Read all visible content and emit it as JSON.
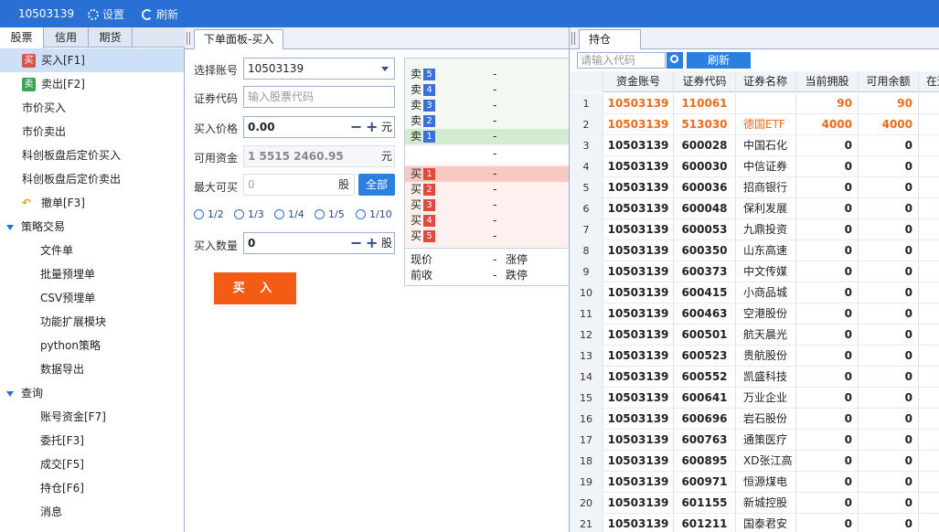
{
  "titlebar": {
    "account": "10503139",
    "settings": "设置",
    "refresh": "刷新"
  },
  "left": {
    "tabs": [
      "股票",
      "信用",
      "期货"
    ],
    "items": [
      {
        "label": "买入[F1]",
        "badge": "买",
        "badge_color": "#d9534f",
        "selected": true
      },
      {
        "label": "卖出[F2]",
        "badge": "卖",
        "badge_color": "#3aa552"
      },
      {
        "label": "市价买入"
      },
      {
        "label": "市价卖出"
      },
      {
        "label": "科创板盘后定价买入"
      },
      {
        "label": "科创板盘后定价卖出"
      },
      {
        "label": "撤单[F3]"
      }
    ],
    "strategy": {
      "header": "策略交易",
      "items": [
        "文件单",
        "批量预埋单",
        "CSV预埋单",
        "功能扩展模块",
        "python策略",
        "数据导出"
      ]
    },
    "query": {
      "header": "查询",
      "items": [
        "账号资金[F7]",
        "委托[F3]",
        "成交[F5]",
        "持仓[F6]",
        "消息"
      ]
    }
  },
  "order_panel": {
    "tab": "下单面板-买入",
    "account_label": "选择账号",
    "account_value": "10503139",
    "code_label": "证券代码",
    "code_placeholder": "输入股票代码",
    "price_label": "买入价格",
    "price_value": "0.00",
    "price_unit": "元",
    "funds_label": "可用资金",
    "funds_value": "1 5515 2460.95",
    "funds_unit": "元",
    "max_label": "最大可买",
    "max_value": "0",
    "max_unit": "股",
    "all_button": "全部",
    "fractions": [
      "1/2",
      "1/3",
      "1/4",
      "1/5",
      "1/10"
    ],
    "qty_label": "买入数量",
    "qty_value": "0",
    "qty_unit": "股",
    "buy_button": "买 入"
  },
  "order_book": {
    "sell": [
      {
        "label": "卖",
        "level": "5",
        "value": "-"
      },
      {
        "label": "卖",
        "level": "4",
        "value": "-"
      },
      {
        "label": "卖",
        "level": "3",
        "value": "-"
      },
      {
        "label": "卖",
        "level": "2",
        "value": "-"
      },
      {
        "label": "卖",
        "level": "1",
        "value": "-"
      }
    ],
    "mid": "-",
    "buy": [
      {
        "label": "买",
        "level": "1",
        "value": "-"
      },
      {
        "label": "买",
        "level": "2",
        "value": "-"
      },
      {
        "label": "买",
        "level": "3",
        "value": "-"
      },
      {
        "label": "买",
        "level": "4",
        "value": "-"
      },
      {
        "label": "买",
        "level": "5",
        "value": "-"
      }
    ],
    "current_label": "现价",
    "current_value": "-",
    "limit_up_label": "涨停",
    "prev_close_label": "前收",
    "prev_close_value": "-",
    "limit_down_label": "跌停"
  },
  "positions": {
    "tab": "持仓",
    "search_placeholder": "请输入代码",
    "refresh_button": "刷新",
    "columns": [
      "资金账号",
      "证券代码",
      "证券名称",
      "当前拥股",
      "可用余额",
      "在途"
    ],
    "rows": [
      [
        "1",
        "10503139",
        "110061",
        "",
        "90",
        "90"
      ],
      [
        "2",
        "10503139",
        "513030",
        "德国ETF",
        "4000",
        "4000"
      ],
      [
        "3",
        "10503139",
        "600028",
        "中国石化",
        "0",
        "0"
      ],
      [
        "4",
        "10503139",
        "600030",
        "中信证券",
        "0",
        "0"
      ],
      [
        "5",
        "10503139",
        "600036",
        "招商银行",
        "0",
        "0"
      ],
      [
        "6",
        "10503139",
        "600048",
        "保利发展",
        "0",
        "0"
      ],
      [
        "7",
        "10503139",
        "600053",
        "九鼎投资",
        "0",
        "0"
      ],
      [
        "8",
        "10503139",
        "600350",
        "山东高速",
        "0",
        "0"
      ],
      [
        "9",
        "10503139",
        "600373",
        "中文传媒",
        "0",
        "0"
      ],
      [
        "10",
        "10503139",
        "600415",
        "小商品城",
        "0",
        "0"
      ],
      [
        "11",
        "10503139",
        "600463",
        "空港股份",
        "0",
        "0"
      ],
      [
        "12",
        "10503139",
        "600501",
        "航天晨光",
        "0",
        "0"
      ],
      [
        "13",
        "10503139",
        "600523",
        "贵航股份",
        "0",
        "0"
      ],
      [
        "14",
        "10503139",
        "600552",
        "凯盛科技",
        "0",
        "0"
      ],
      [
        "15",
        "10503139",
        "600641",
        "万业企业",
        "0",
        "0"
      ],
      [
        "16",
        "10503139",
        "600696",
        "岩石股份",
        "0",
        "0"
      ],
      [
        "17",
        "10503139",
        "600763",
        "通策医疗",
        "0",
        "0"
      ],
      [
        "18",
        "10503139",
        "600895",
        "XD张江高",
        "0",
        "0"
      ],
      [
        "19",
        "10503139",
        "600971",
        "恒源煤电",
        "0",
        "0"
      ],
      [
        "20",
        "10503139",
        "601155",
        "新城控股",
        "0",
        "0"
      ],
      [
        "21",
        "10503139",
        "601211",
        "国泰君安",
        "0",
        "0"
      ]
    ],
    "highlight_color": "#ee6a1a"
  }
}
